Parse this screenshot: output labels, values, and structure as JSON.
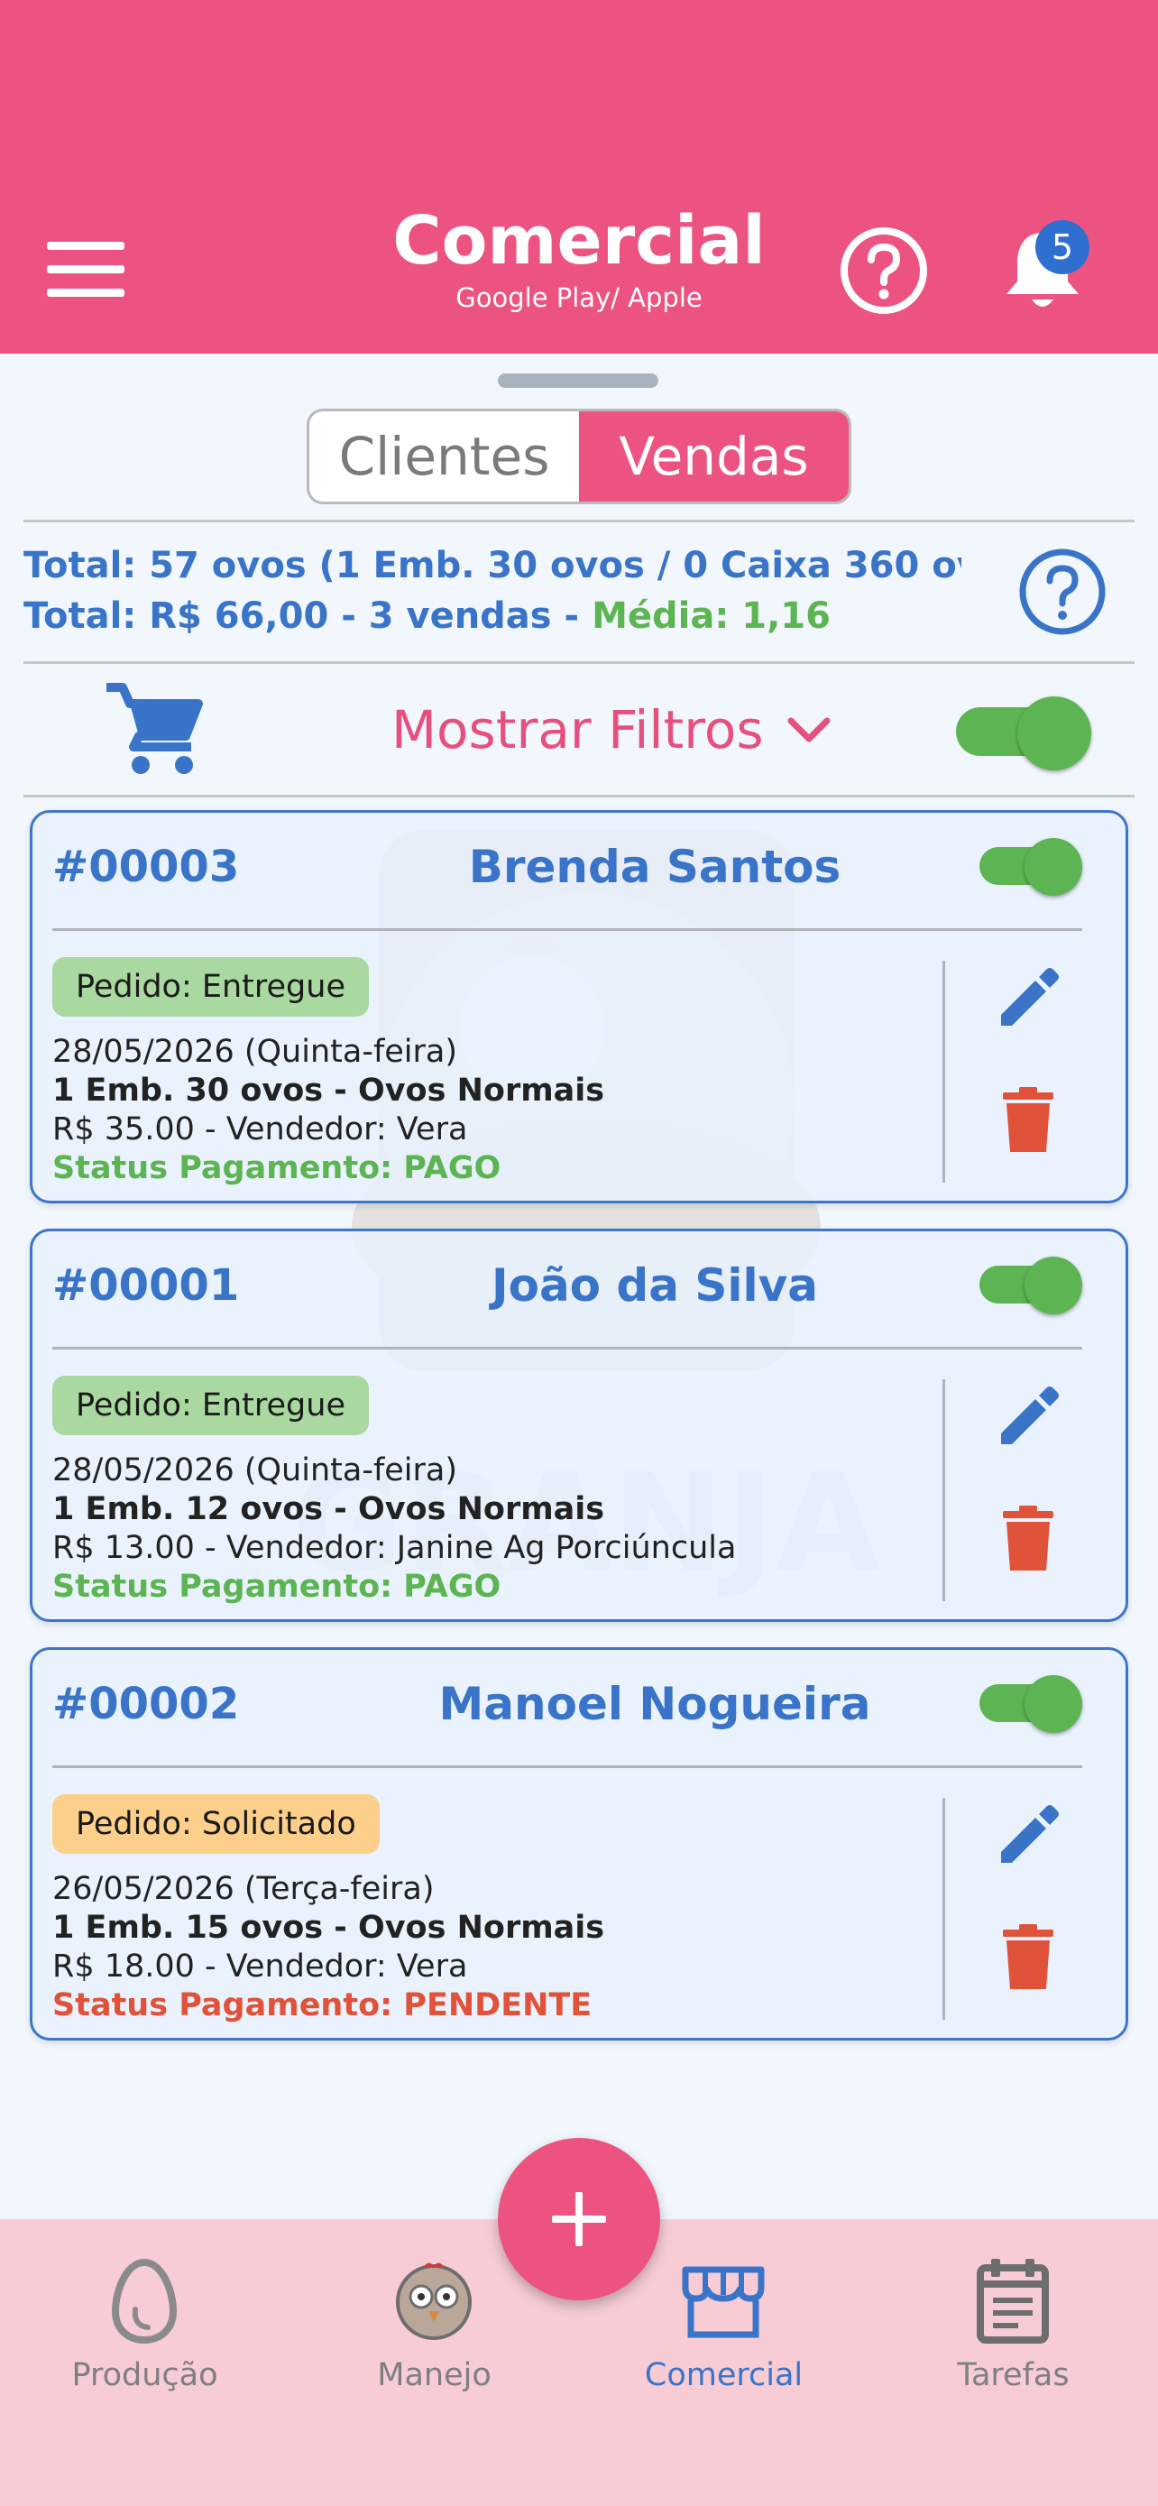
{
  "header": {
    "title": "Comercial",
    "subtitle": "Google Play/ Apple",
    "notification_count": "5",
    "icons": [
      "menu-icon",
      "help-icon",
      "bell-icon"
    ],
    "color": "#ec5380"
  },
  "tabs": [
    {
      "label": "Clientes",
      "selected": false
    },
    {
      "label": "Vendas",
      "selected": true
    }
  ],
  "summary": {
    "line1": "Total: 57 ovos (1 Emb. 30 ovos / 0 Caixa 360 ov...",
    "line2_prefix": "Total: R$  66,00 - 3 vendas - ",
    "line2_avg": "Média:  1,16"
  },
  "filters": {
    "label": "Mostrar Filtros",
    "toggle_on": true
  },
  "sales": [
    {
      "number": "#00003",
      "client": "Brenda Santos",
      "order_status": "Pedido: Entregue",
      "date": "28/05/2026 (Quinta-feira)",
      "product": "1 Emb. 30 ovos - Ovos Normais",
      "price_seller": "R$ 35.00 - Vendedor: Vera",
      "payment_status": "Status Pagamento: PAGO",
      "toggle_on": true
    },
    {
      "number": "#00001",
      "client": "João da Silva",
      "order_status": "Pedido: Entregue",
      "date": "28/05/2026 (Quinta-feira)",
      "product": "1 Emb. 12 ovos - Ovos Normais",
      "price_seller": "R$ 13.00 - Vendedor: Janine Ag Porciúncula",
      "payment_status": "Status Pagamento: PAGO",
      "toggle_on": true
    },
    {
      "number": "#00002",
      "client": "Manoel Nogueira",
      "order_status": "Pedido: Solicitado",
      "date": "26/05/2026 (Terça-feira)",
      "product": "1 Emb. 15 ovos - Ovos Normais",
      "price_seller": "R$ 18.00 - Vendedor: Vera",
      "payment_status": "Status Pagamento: PENDENTE",
      "toggle_on": true
    }
  ],
  "watermark": {
    "text": "GRANJA NA MÃO"
  },
  "bottom_nav": [
    {
      "label": "Produção",
      "icon": "egg-icon",
      "active": false
    },
    {
      "label": "Manejo",
      "icon": "chicken-icon",
      "active": false
    },
    {
      "label": "Comercial",
      "icon": "store-icon",
      "active": true
    },
    {
      "label": "Tarefas",
      "icon": "clipboard-icon",
      "active": false
    }
  ],
  "colors": {
    "accent": "#ec5380",
    "blue": "#3a74c9",
    "green": "#5db452",
    "red": "#e0523a",
    "nav_bg": "#f7ccd5"
  }
}
